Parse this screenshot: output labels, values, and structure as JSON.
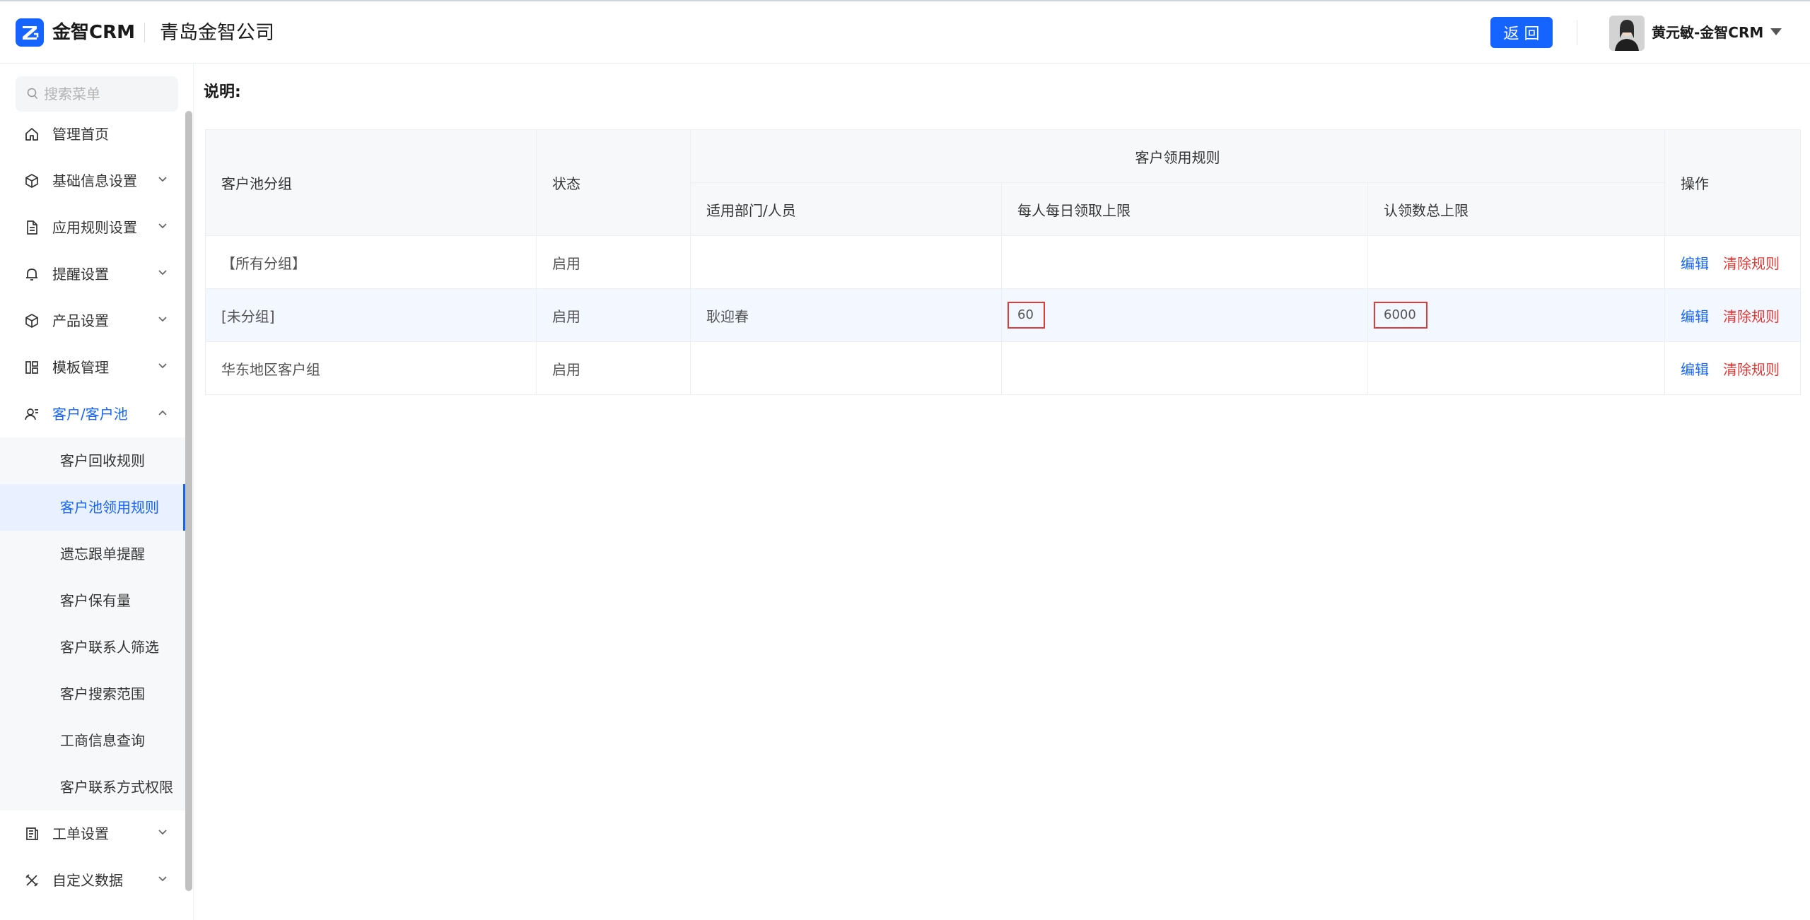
{
  "header": {
    "brand": "金智CRM",
    "company": "青岛金智公司",
    "back_label": "返 回",
    "user_name": "黄元敏-金智CRM"
  },
  "sidebar": {
    "search_placeholder": "搜索菜单",
    "items": [
      {
        "label": "管理首页",
        "icon": "home-icon"
      },
      {
        "label": "基础信息设置",
        "icon": "cube-icon"
      },
      {
        "label": "应用规则设置",
        "icon": "document-icon"
      },
      {
        "label": "提醒设置",
        "icon": "bell-icon"
      },
      {
        "label": "产品设置",
        "icon": "box-icon"
      },
      {
        "label": "模板管理",
        "icon": "template-icon"
      },
      {
        "label": "客户/客户池",
        "icon": "customer-icon"
      },
      {
        "label": "工单设置",
        "icon": "ticket-icon"
      },
      {
        "label": "自定义数据",
        "icon": "tools-icon"
      }
    ],
    "sub_items": [
      {
        "label": "客户回收规则"
      },
      {
        "label": "客户池领用规则"
      },
      {
        "label": "遗忘跟单提醒"
      },
      {
        "label": "客户保有量"
      },
      {
        "label": "客户联系人筛选"
      },
      {
        "label": "客户搜索范围"
      },
      {
        "label": "工商信息查询"
      },
      {
        "label": "客户联系方式权限"
      }
    ]
  },
  "main": {
    "note_title": "说明:",
    "table": {
      "headers": {
        "group": "客户池分组",
        "status": "状态",
        "rule": "客户领用规则",
        "dept": "适用部门/人员",
        "daily": "每人每日领取上限",
        "total": "认领数总上限",
        "ops": "操作"
      },
      "rows": [
        {
          "group": "【所有分组】",
          "status": "启用",
          "dept": "",
          "daily": "",
          "total": ""
        },
        {
          "group": "[未分组]",
          "status": "启用",
          "dept": "耿迎春",
          "daily": "60",
          "total": "6000"
        },
        {
          "group": "华东地区客户组",
          "status": "启用",
          "dept": "",
          "daily": "",
          "total": ""
        }
      ],
      "edit_label": "编辑",
      "clear_label": "清除规则"
    }
  },
  "colors": {
    "primary": "#1664ff",
    "danger": "#e53935"
  }
}
